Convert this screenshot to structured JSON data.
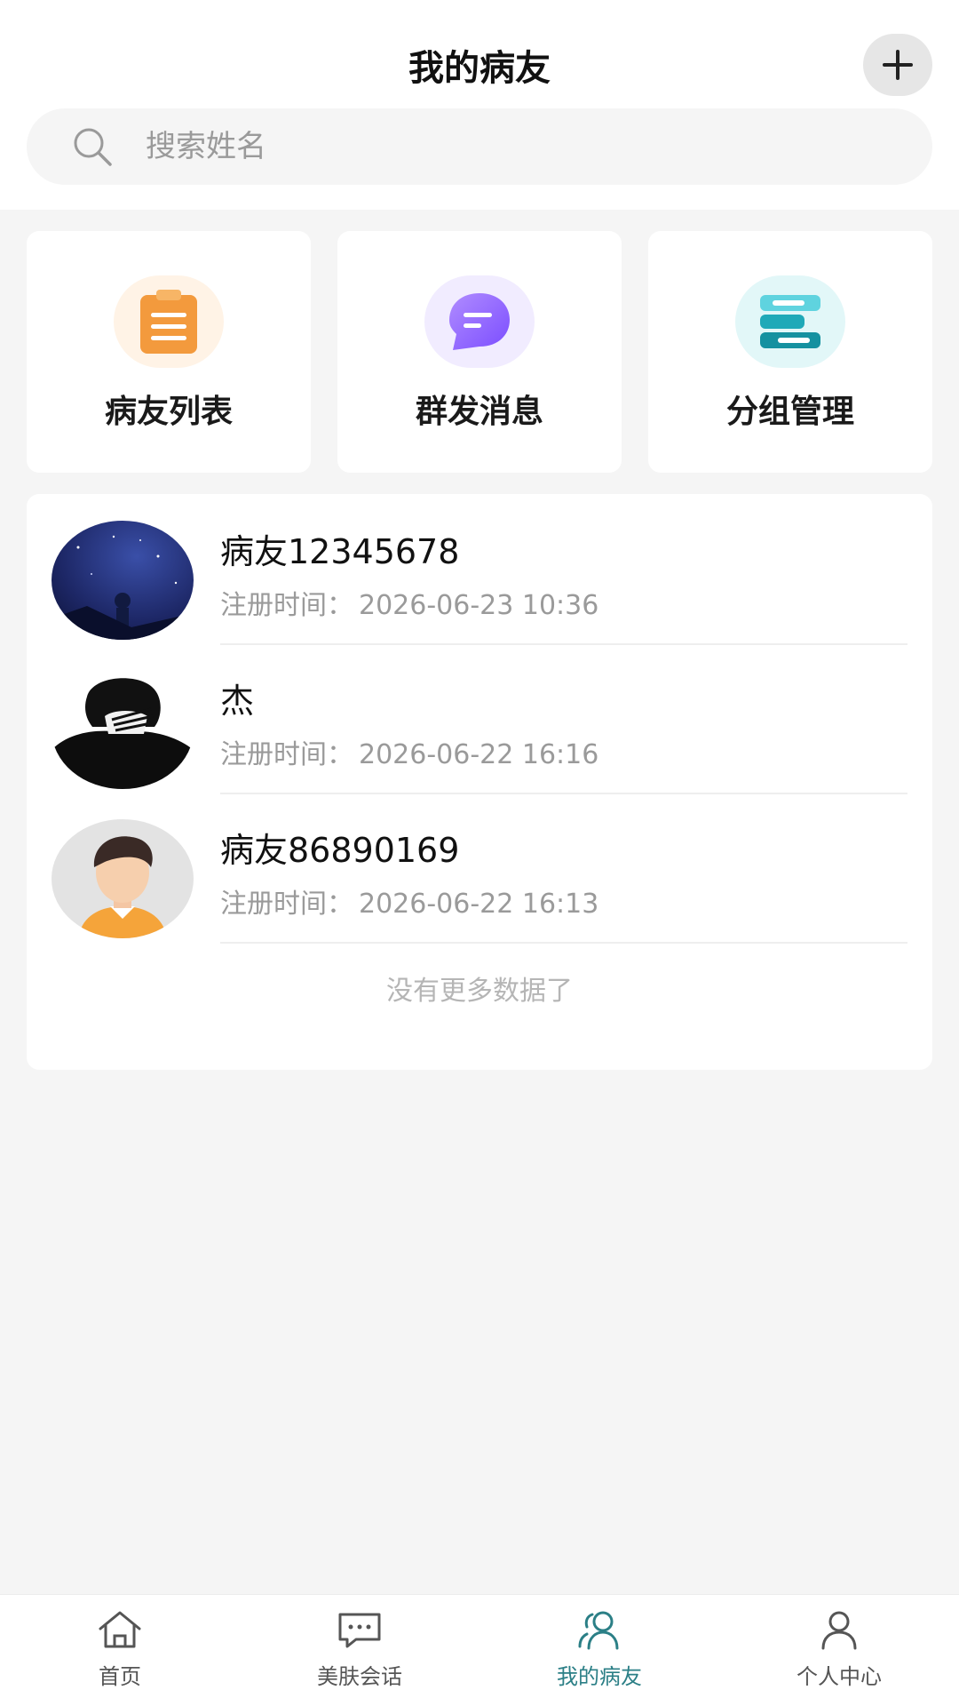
{
  "header": {
    "title": "我的病友"
  },
  "search": {
    "placeholder": "搜索姓名"
  },
  "actions": [
    {
      "label": "病友列表",
      "icon": "clipboard-list-icon"
    },
    {
      "label": "群发消息",
      "icon": "chat-bubble-icon"
    },
    {
      "label": "分组管理",
      "icon": "group-manage-icon"
    }
  ],
  "patients": [
    {
      "name": "病友12345678",
      "time_label": "注册时间：",
      "time": "2026-06-23 10:36"
    },
    {
      "name": "杰",
      "time_label": "注册时间：",
      "time": "2026-06-22 16:16"
    },
    {
      "name": "病友86890169",
      "time_label": "注册时间：",
      "time": "2026-06-22 16:13"
    }
  ],
  "list_footer": "没有更多数据了",
  "tabs": [
    {
      "label": "首页",
      "icon": "home-icon"
    },
    {
      "label": "美肤会话",
      "icon": "chat-icon"
    },
    {
      "label": "我的病友",
      "icon": "patients-icon",
      "active": true
    },
    {
      "label": "个人中心",
      "icon": "person-icon"
    }
  ],
  "colors": {
    "accent": "#2b7f86",
    "background": "#f5f5f5",
    "card": "#ffffff"
  }
}
